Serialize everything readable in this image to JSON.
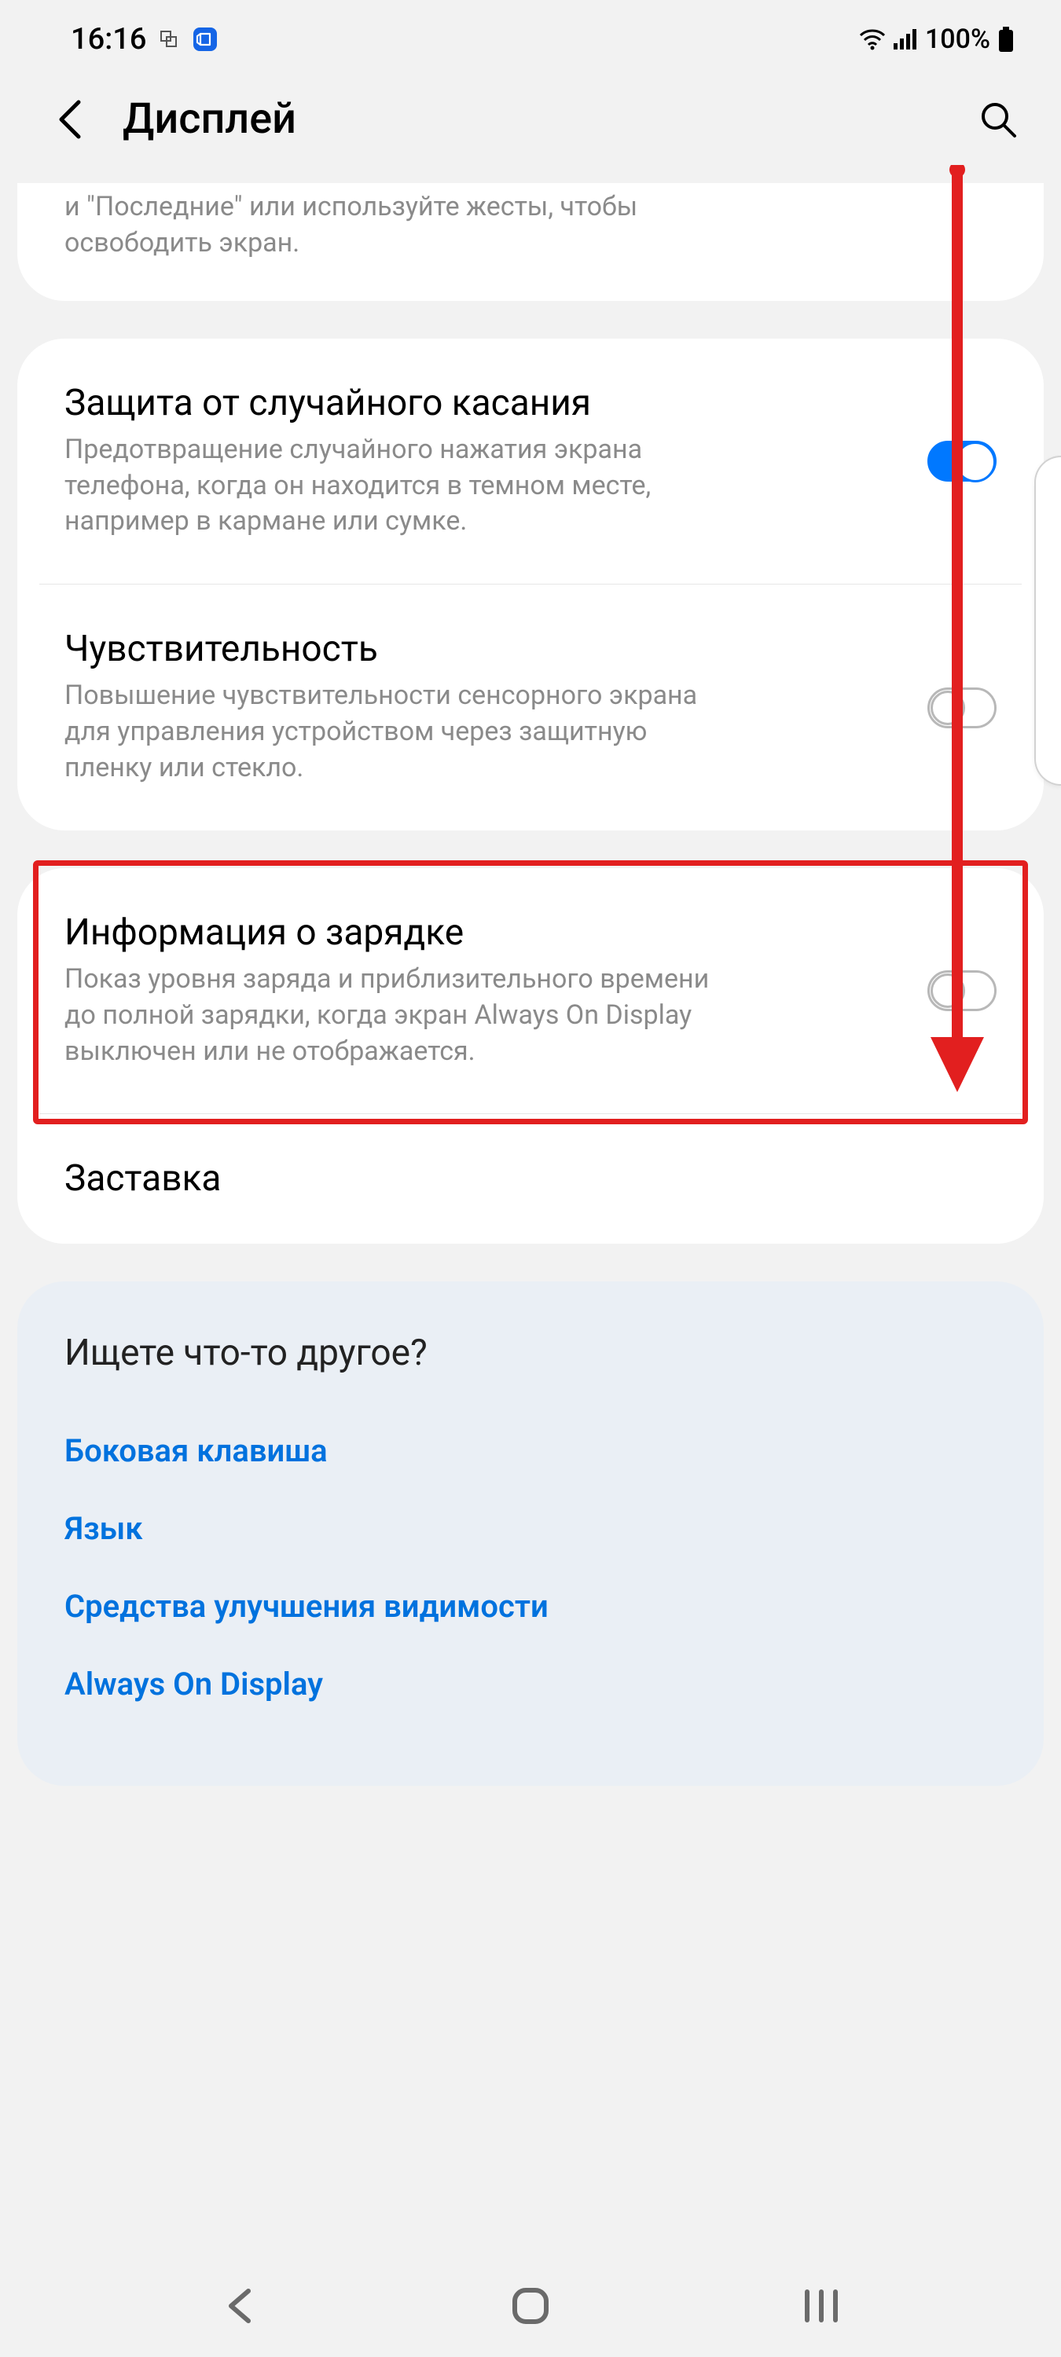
{
  "statusbar": {
    "time": "16:16",
    "battery_text": "100%"
  },
  "header": {
    "title": "Дисплей"
  },
  "partial_row": {
    "desc": "и \"Последние\" или используйте жесты, чтобы освободить экран."
  },
  "group2": {
    "item1": {
      "title": "Защита от случайного касания",
      "desc": "Предотвращение случайного нажатия экрана телефона, когда он находится в темном месте, например в кармане или сумке.",
      "enabled": true
    },
    "item2": {
      "title": "Чувствительность",
      "desc": "Повышение чувствительности сенсорного экрана для управления устройством через защитную пленку или стекло.",
      "enabled": false
    }
  },
  "group3": {
    "item1": {
      "title": "Информация о зарядке",
      "desc": "Показ уровня заряда и приблизительного времени до полной зарядки, когда экран Always On Display выключен или не отображается.",
      "enabled": false
    },
    "item2": {
      "title": "Заставка"
    }
  },
  "tip": {
    "hint": "Ищете что-то другое?",
    "links": [
      "Боковая клавиша",
      "Язык",
      "Средства улучшения видимости",
      "Always On Display"
    ]
  },
  "annotation": {
    "color": "#e21f1f"
  }
}
